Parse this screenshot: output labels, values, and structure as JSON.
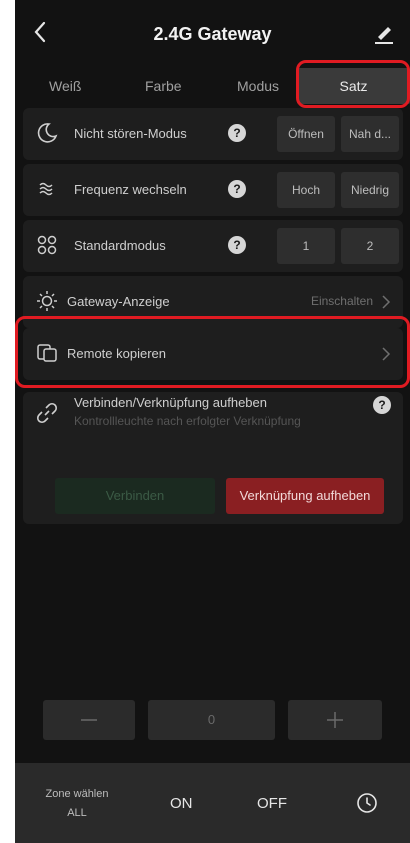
{
  "header": {
    "title": "2.4G Gateway"
  },
  "tabs": [
    {
      "label": "Weiß"
    },
    {
      "label": "Farbe"
    },
    {
      "label": "Modus"
    },
    {
      "label": "Satz"
    }
  ],
  "rows": {
    "dnd": {
      "label": "Nicht stören-Modus",
      "help": "?",
      "opt1": "Öffnen",
      "opt2": "Nah d..."
    },
    "freq": {
      "label": "Frequenz wechseln",
      "help": "?",
      "opt1": "Hoch",
      "opt2": "Niedrig"
    },
    "std": {
      "label": "Standardmodus",
      "help": "?",
      "opt1": "1",
      "opt2": "2"
    },
    "gateway": {
      "label": "Gateway-Anzeige",
      "value": "Einschalten"
    },
    "remote": {
      "label": "Remote kopieren"
    }
  },
  "connect": {
    "title": "Verbinden/Verknüpfung aufheben",
    "subtitle": "Kontrollleuchte nach erfolgter Verknüpfung",
    "help": "?",
    "connect_label": "Verbinden",
    "unlink_label": "Verknüpfung aufheben"
  },
  "stepper": {
    "value": "0"
  },
  "bottom": {
    "zone_label": "Zone wählen",
    "zone_value": "ALL",
    "on_label": "ON",
    "off_label": "OFF"
  },
  "colors": {
    "accent_red": "#e01b22",
    "unlink_button": "#8a1f22",
    "background": "#121212"
  },
  "icons": {
    "back": "chevron-left-icon",
    "edit": "pencil-icon",
    "dnd": "moon-icon",
    "freq": "wave-icon",
    "std": "grid-icon",
    "gateway": "sun-icon",
    "remote": "copy-remote-icon",
    "connect": "link-icon",
    "clock": "clock-icon"
  }
}
